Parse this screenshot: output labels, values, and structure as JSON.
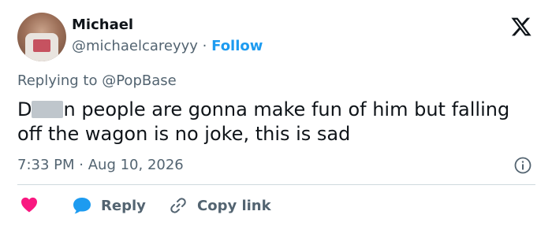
{
  "author": {
    "name": "Michael",
    "handle": "@michaelcareyyy",
    "separator": "·",
    "follow_label": "Follow"
  },
  "reply_to": {
    "prefix": "Replying to",
    "mention": "@PopBase"
  },
  "post": {
    "text_start": "D",
    "text_rest": "n people are gonna make fun of him but falling off the wagon is no joke, this is sad",
    "time": "7:33 PM",
    "separator": "·",
    "date": "Aug 10, 2026"
  },
  "actions": {
    "reply_label": "Reply",
    "copy_link_label": "Copy link"
  },
  "icons": {
    "platform": "x-logo-icon",
    "info": "info-icon",
    "like": "heart-icon",
    "reply": "speech-bubble-icon",
    "copy": "link-icon"
  },
  "colors": {
    "accent": "#1d9bf0",
    "like": "#f91880",
    "muted": "#536471",
    "text": "#0f1419"
  }
}
